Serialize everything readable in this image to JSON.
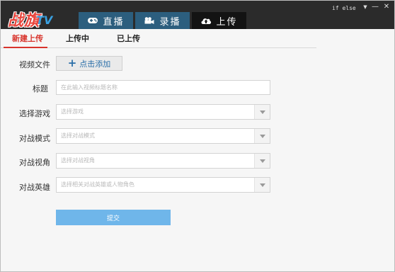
{
  "app": {
    "logo_main": "战旗",
    "logo_tv": "TV"
  },
  "nav": {
    "tabs": [
      {
        "label": "直播",
        "icon": "gamepad-icon"
      },
      {
        "label": "录播",
        "icon": "video-camera-icon"
      },
      {
        "label": "上传",
        "icon": "cloud-upload-icon"
      }
    ],
    "active": "上传"
  },
  "window": {
    "caption_text": "if else",
    "dropdown": "▼",
    "minimize": "—",
    "close": "✕"
  },
  "subtabs": {
    "items": [
      "新建上传",
      "上传中",
      "已上传"
    ],
    "active": "新建上传"
  },
  "form": {
    "video_file": {
      "label": "视频文件",
      "button": "点击添加"
    },
    "title": {
      "label": "标题",
      "placeholder": "在此输入视频标题名称"
    },
    "game": {
      "label": "选择游戏",
      "placeholder": "选择游戏"
    },
    "battle_mode": {
      "label": "对战模式",
      "placeholder": "选择对战模式"
    },
    "battle_view": {
      "label": "对战视角",
      "placeholder": "选择对战视角"
    },
    "battle_hero": {
      "label": "对战英雄",
      "placeholder": "选择相关对战英雄或人物角色"
    },
    "submit": "提交"
  },
  "colors": {
    "accent_red": "#d8342c",
    "nav_tab": "#2c5e7e",
    "nav_active": "#131313",
    "submit": "#6fb6ea",
    "link_blue": "#2a6ea8"
  }
}
